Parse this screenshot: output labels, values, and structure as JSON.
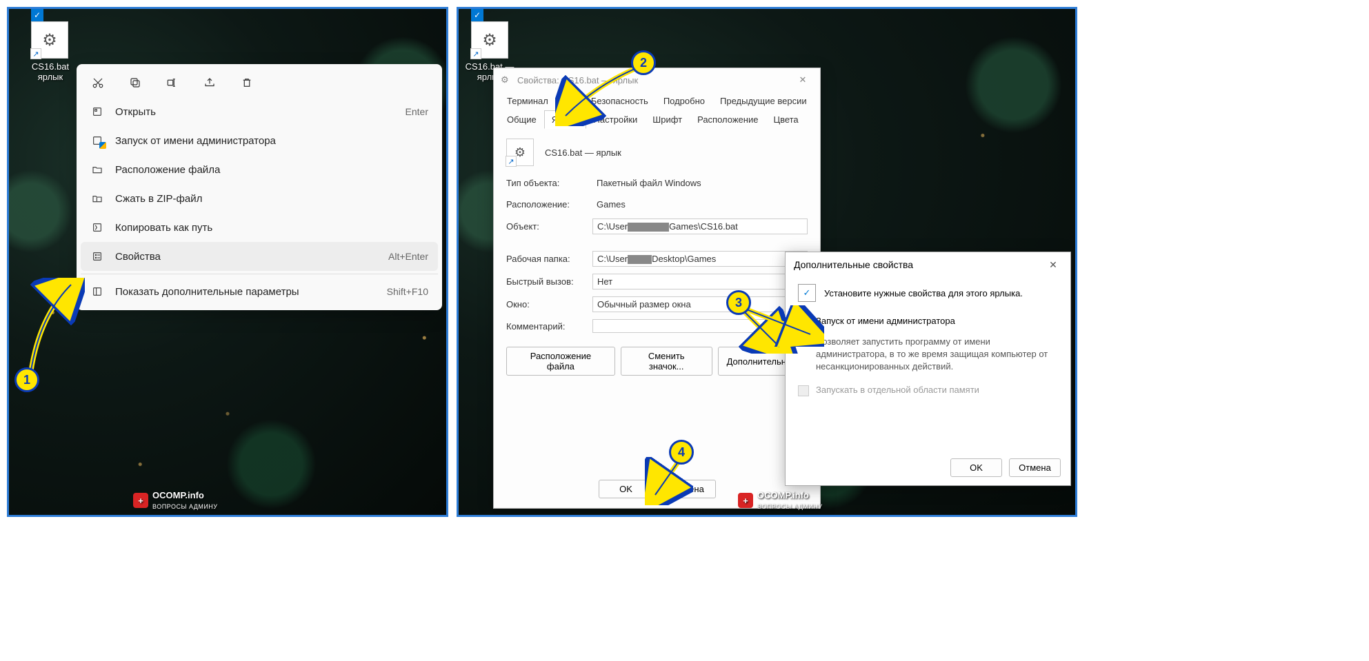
{
  "shortcut": {
    "label": "CS16.bat — ярлык",
    "label_left": "CS16.bat\nярлык"
  },
  "context_menu": {
    "open": "Открыть",
    "open_key": "Enter",
    "run_admin": "Запуск от имени администратора",
    "file_location": "Расположение файла",
    "zip": "Сжать в ZIP-файл",
    "copy_path": "Копировать как путь",
    "properties": "Свойства",
    "properties_key": "Alt+Enter",
    "show_more": "Показать дополнительные параметры",
    "show_more_key": "Shift+F10"
  },
  "props": {
    "title": "Свойства: CS16.bat — ярлык",
    "tabs": {
      "terminal": "Терминал",
      "security": "Безопасность",
      "details": "Подробно",
      "prev_versions": "Предыдущие версии",
      "general": "Общие",
      "shortcut": "Ярлык",
      "settings": "Настройки",
      "font": "Шрифт",
      "layout": "Расположение",
      "colors": "Цвета"
    },
    "header_name": "CS16.bat — ярлык",
    "type_label": "Тип объекта:",
    "type_value": "Пакетный файл Windows",
    "location_label": "Расположение:",
    "location_value": "Games",
    "target_label": "Объект:",
    "target_prefix": "C:\\User",
    "target_suffix": "Games\\CS16.bat",
    "workdir_label": "Рабочая папка:",
    "workdir_prefix": "C:\\User",
    "workdir_middle": "Desktop\\Games",
    "hotkey_label": "Быстрый вызов:",
    "hotkey_value": "Нет",
    "window_label": "Окно:",
    "window_value": "Обычный размер окна",
    "comment_label": "Комментарий:",
    "comment_value": "",
    "btn_file_loc": "Расположение файла",
    "btn_change_icon": "Сменить значок...",
    "btn_advanced": "Дополнительно...",
    "btn_ok": "OK",
    "btn_cancel": "Отмена"
  },
  "adv": {
    "title": "Дополнительные свойства",
    "intro": "Установите нужные свойства для этого ярлыка.",
    "run_admin": "Запуск от имени администратора",
    "run_admin_desc": "Позволяет запустить программу от имени администратора, в то же время защищая компьютер от несанкционированных действий.",
    "sep_memory": "Запускать в отдельной области памяти",
    "btn_ok": "OK",
    "btn_cancel": "Отмена"
  },
  "watermark": {
    "domain": "OCOMP.info",
    "sub": "ВОПРОСЫ АДМИНУ"
  },
  "bubbles": {
    "one": "1",
    "two": "2",
    "three": "3",
    "four": "4"
  }
}
